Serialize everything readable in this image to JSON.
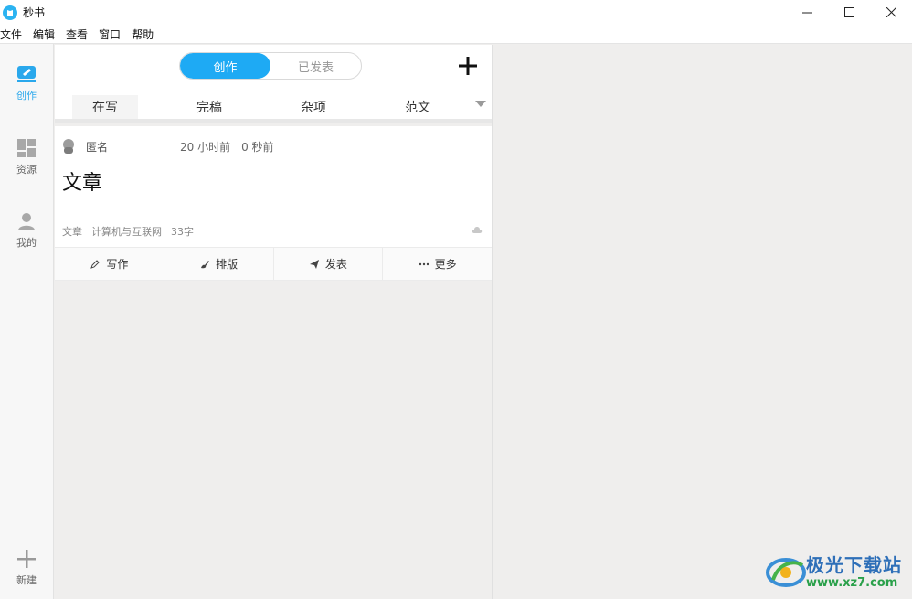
{
  "app": {
    "title": "秒书"
  },
  "menubar": {
    "items": [
      "文件",
      "编辑",
      "查看",
      "窗口",
      "帮助"
    ]
  },
  "leftnav": {
    "items": [
      {
        "label": "创作",
        "icon": "compose-icon",
        "active": true
      },
      {
        "label": "资源",
        "icon": "grid-icon",
        "active": false
      },
      {
        "label": "我的",
        "icon": "user-icon",
        "active": false
      }
    ],
    "new_label": "新建"
  },
  "segment": {
    "options": [
      "创作",
      "已发表"
    ],
    "selected": "创作"
  },
  "tabs": {
    "items": [
      "在写",
      "完稿",
      "杂项",
      "范文"
    ],
    "selected": "在写"
  },
  "card": {
    "author": "匿名",
    "time": "20 小时前　0 秒前",
    "title": "文章",
    "meta": [
      "文章",
      "计算机与互联网",
      "33字"
    ]
  },
  "actions": [
    "写作",
    "排版",
    "发表",
    "更多"
  ],
  "watermark": {
    "text": "极光下载站",
    "url": "www.xz7.com"
  },
  "colors": {
    "accent": "#1eaaf4",
    "panel_bg": "#efeeed"
  }
}
